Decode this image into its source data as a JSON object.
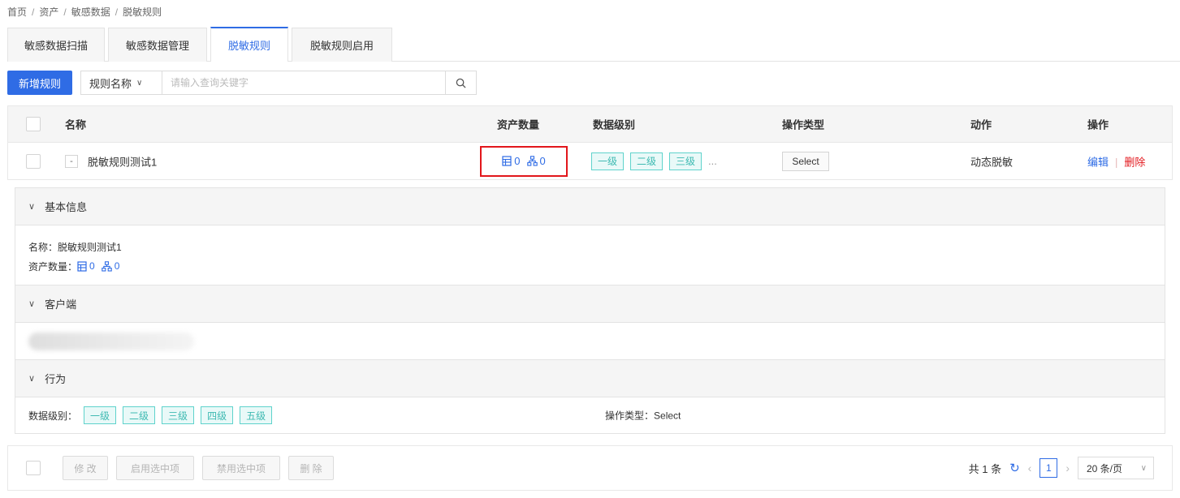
{
  "breadcrumb": [
    "首页",
    "资产",
    "敏感数据",
    "脱敏规则"
  ],
  "breadcrumb_sep": "/",
  "tabs": [
    {
      "label": "敏感数据扫描",
      "active": false
    },
    {
      "label": "敏感数据管理",
      "active": false
    },
    {
      "label": "脱敏规则",
      "active": true
    },
    {
      "label": "脱敏规则启用",
      "active": false
    }
  ],
  "toolbar": {
    "add_label": "新增规则",
    "search_field": "规则名称",
    "search_placeholder": "请输入查询关键字",
    "search_icon": "search-icon"
  },
  "table": {
    "columns": {
      "name": "名称",
      "asset_count": "资产数量",
      "data_level": "数据级别",
      "op_type": "操作类型",
      "action": "动作",
      "operations": "操作"
    },
    "rows": [
      {
        "expand_symbol": "-",
        "name": "脱敏规则测试1",
        "table_count": "0",
        "db_count": "0",
        "levels": [
          "一级",
          "二级",
          "三级"
        ],
        "levels_more": "...",
        "op_type": "Select",
        "action": "动态脱敏",
        "edit_label": "编辑",
        "delete_label": "删除"
      }
    ]
  },
  "detail": {
    "basic": {
      "title": "基本信息",
      "name_label": "名称：",
      "name_value": "脱敏规则测试1",
      "count_label": "资产数量：",
      "table_count": "0",
      "db_count": "0"
    },
    "client": {
      "title": "客户端"
    },
    "behavior": {
      "title": "行为",
      "level_label": "数据级别：",
      "levels": [
        "一级",
        "二级",
        "三级",
        "四级",
        "五级"
      ],
      "op_label": "操作类型：",
      "op_value": "Select"
    }
  },
  "footer": {
    "batch_buttons": [
      "修 改",
      "启用选中项",
      "禁用选中项",
      "删 除"
    ],
    "total_text": "共 1 条",
    "current_page": "1",
    "page_size": "20 条/页"
  },
  "colors": {
    "primary": "#2f6ce5",
    "danger": "#e2161b",
    "tag_border": "#5fd3cc",
    "tag_text": "#3fbab2"
  }
}
